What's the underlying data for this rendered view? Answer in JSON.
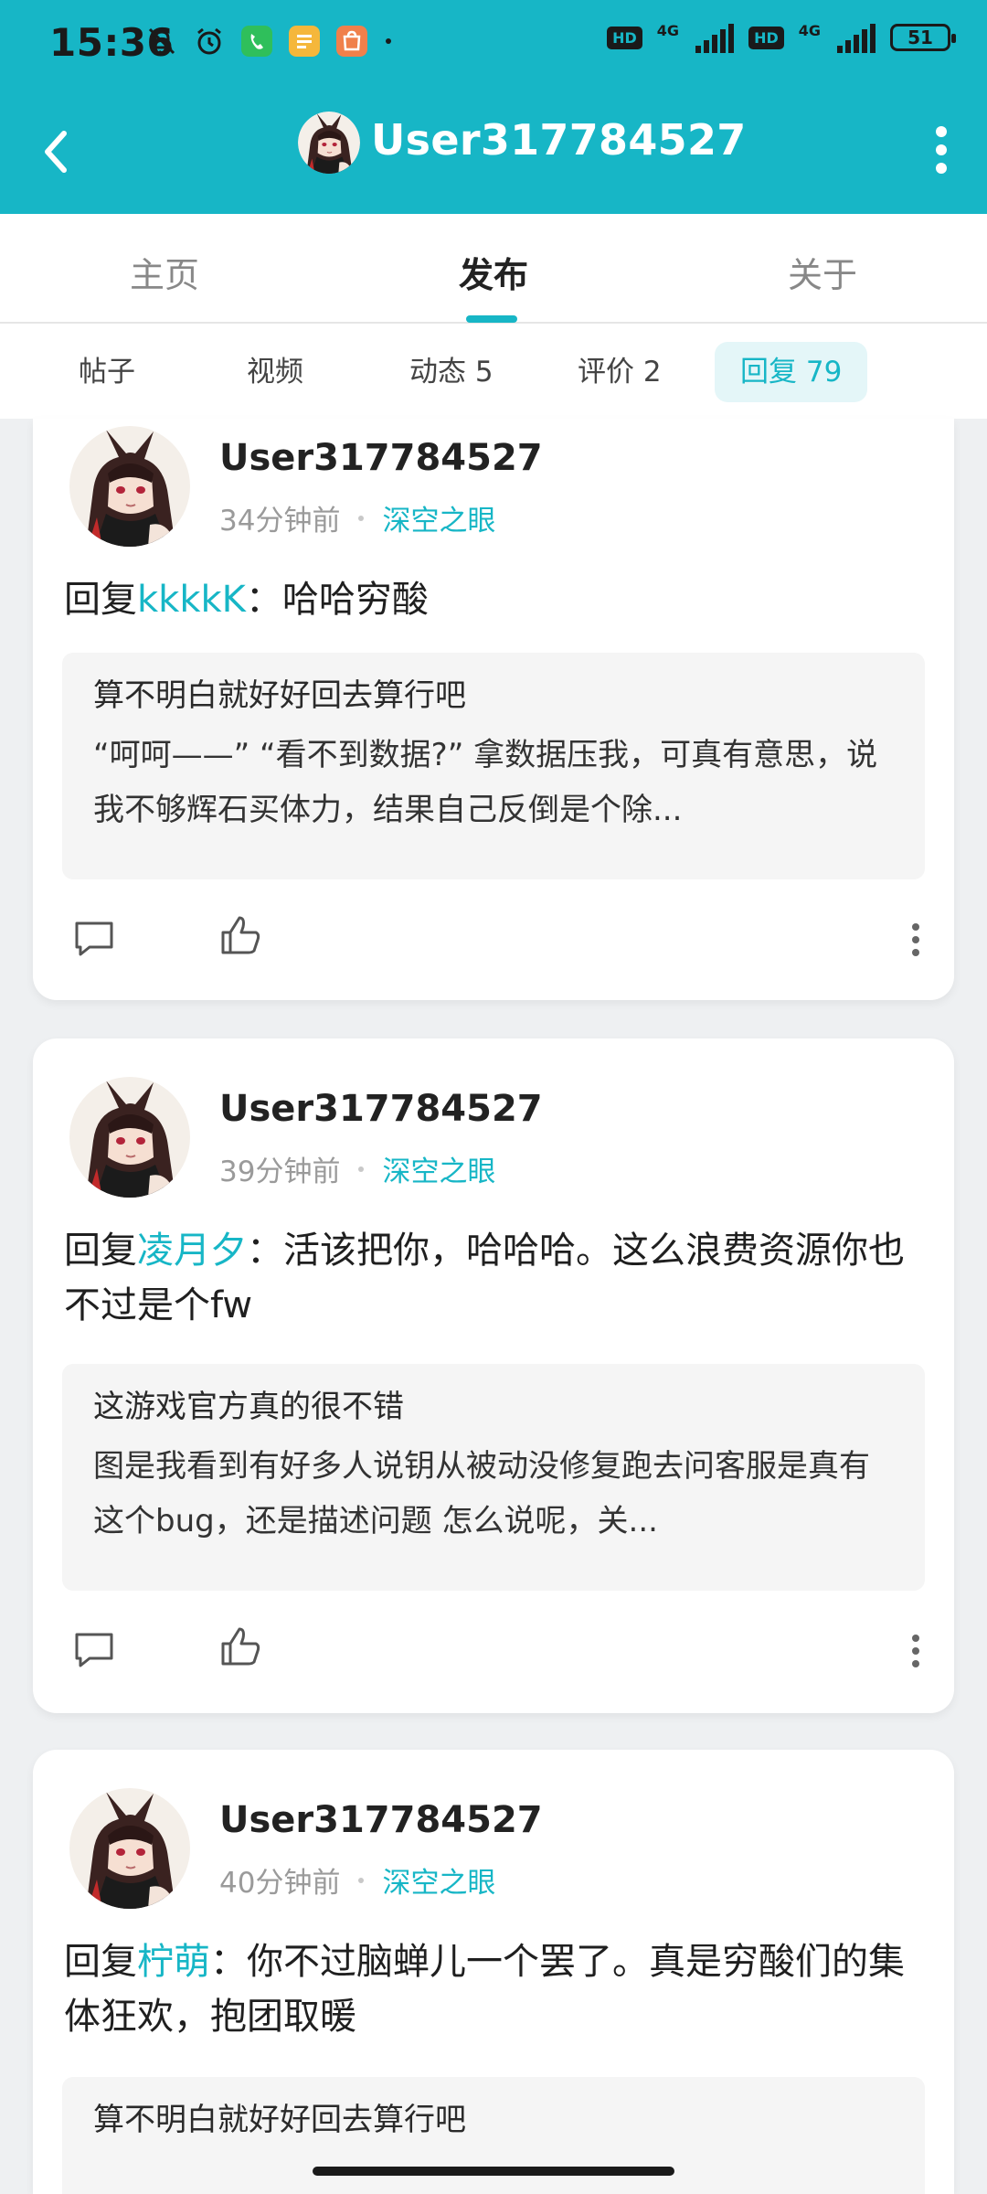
{
  "status_bar": {
    "time": "15:36",
    "battery": "51",
    "network_label": "4G",
    "hd_label": "HD"
  },
  "header": {
    "title": "User317784527"
  },
  "tabs": [
    {
      "label": "主页"
    },
    {
      "label": "发布",
      "active": true
    },
    {
      "label": "关于"
    }
  ],
  "subtabs": [
    {
      "label": "帖子"
    },
    {
      "label": "视频"
    },
    {
      "label": "动态 5"
    },
    {
      "label": "评价 2"
    },
    {
      "label": "回复 79",
      "active": true
    }
  ],
  "posts": [
    {
      "username": "User317784527",
      "time": "34分钟前",
      "circle": "深空之眼",
      "reply_prefix": "回复",
      "mention": "kkkkK",
      "text": "：哈哈穷酸",
      "quote_title": "算不明白就好好回去算行吧",
      "quote_body": "“呵呵——” “看不到数据?” 拿数据压我，可真有意思，说我不够辉石买体力，结果自己反倒是个除..."
    },
    {
      "username": "User317784527",
      "time": "39分钟前",
      "circle": "深空之眼",
      "reply_prefix": "回复",
      "mention": "凌月夕",
      "text": "：活该把你，哈哈哈。这么浪费资源你也不过是个fw",
      "quote_title": "这游戏官方真的很不错",
      "quote_body": "图是我看到有好多人说钥从被动没修复跑去问客服是真有这个bug，还是描述问题  怎么说呢，关..."
    },
    {
      "username": "User317784527",
      "time": "40分钟前",
      "circle": "深空之眼",
      "reply_prefix": "回复",
      "mention": "柠萌",
      "text": "：你不过脑蝉儿一个罢了。真是穷酸们的集体狂欢，抱团取暖",
      "quote_title": "算不明白就好好回去算行吧",
      "quote_body": ""
    }
  ],
  "colors": {
    "accent": "#17b6c6",
    "background": "#eef0f2"
  }
}
